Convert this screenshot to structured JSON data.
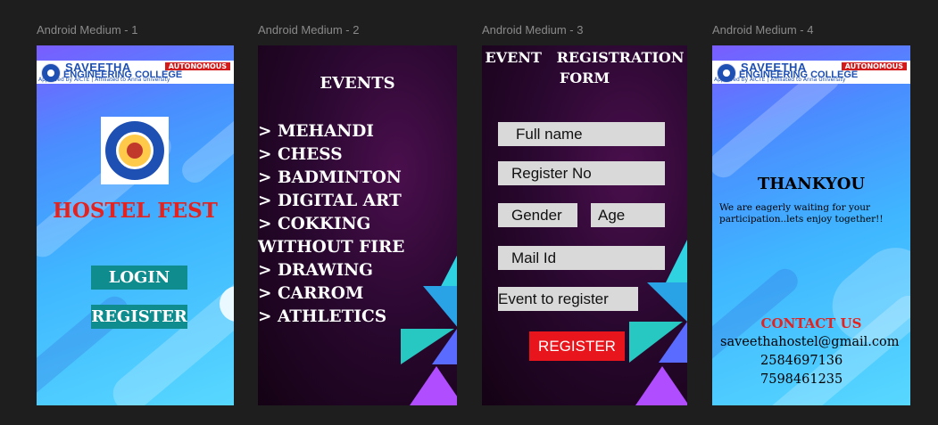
{
  "frames": [
    {
      "label": "Android Medium - 1"
    },
    {
      "label": "Android Medium - 2"
    },
    {
      "label": "Android Medium - 3"
    },
    {
      "label": "Android Medium - 4"
    }
  ],
  "banner": {
    "name_line1": "SAVEETHA",
    "name_line2": "ENGINEERING COLLEGE",
    "badge": "AUTONOMOUS",
    "subtitle": "Approved by AICTE | Affiliated to Anna University"
  },
  "screen1": {
    "title": "HOSTEL FEST",
    "login_label": "LOGIN",
    "register_label": "REGISTER"
  },
  "screen2": {
    "title": "EVENTS",
    "events": [
      "> MEHANDI",
      "> CHESS",
      "> BADMINTON",
      "> DIGITAL ART",
      "> COKKING WITHOUT FIRE",
      "> DRAWING",
      "> CARROM",
      "> ATHLETICS"
    ]
  },
  "screen3": {
    "title_line1": "EVENT   REGISTRATION",
    "title_line2": "FORM",
    "fields": {
      "full_name": "Full name",
      "register_no": "Register No",
      "gender": "Gender",
      "age": "Age",
      "mail_id": "Mail Id",
      "event": "Event to register"
    },
    "register_label": "REGISTER"
  },
  "screen4": {
    "title": "THANKYOU",
    "message": "We are eagerly waiting for  your participation..lets enjoy  together!!",
    "contact_title": "CONTACT US",
    "email": "saveethahostel@gmail.com",
    "phone1": "2584697136",
    "phone2": "7598461235"
  },
  "colors": {
    "canvas": "#1e1e1e",
    "teal_button": "#0f8c8e",
    "red_button": "#e8161c",
    "red_title": "#e3231f",
    "field_bg": "#d9d9d9"
  }
}
